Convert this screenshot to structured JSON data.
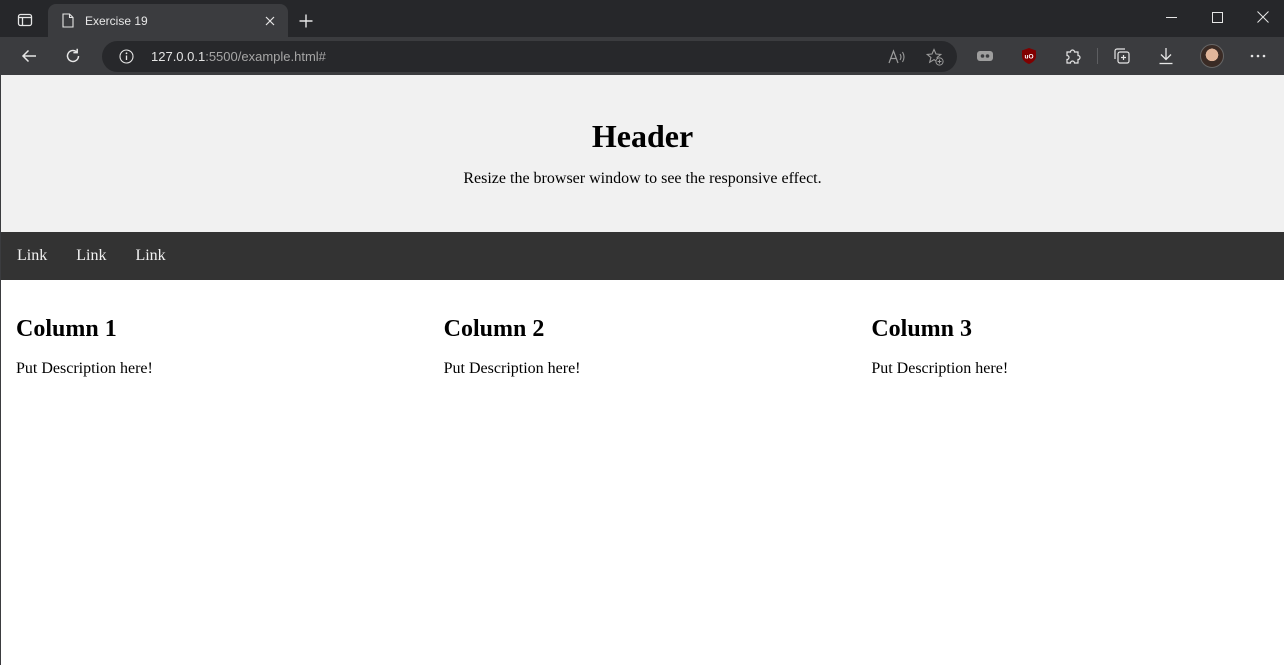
{
  "browser": {
    "tab_title": "Exercise 19",
    "url_host": "127.0.0.1",
    "url_rest": ":5500/example.html#"
  },
  "page": {
    "header": {
      "title": "Header",
      "subtitle": "Resize the browser window to see the responsive effect."
    },
    "nav": {
      "links": [
        "Link",
        "Link",
        "Link"
      ]
    },
    "columns": [
      {
        "title": "Column 1",
        "description": "Put Description here!"
      },
      {
        "title": "Column 2",
        "description": "Put Description here!"
      },
      {
        "title": "Column 3",
        "description": "Put Description here!"
      }
    ]
  },
  "colors": {
    "header_bg": "#f1f1f1",
    "nav_bg": "#333333",
    "nav_link": "#f2f2f2",
    "browser_toolbar": "#3b3c3f",
    "ublock_red": "#800000"
  },
  "icons": {
    "tab_actions": "tab-actions-icon",
    "page": "page-icon",
    "close": "close-icon",
    "new_tab": "plus-icon",
    "back": "arrow-left-icon",
    "reload": "reload-icon",
    "info": "info-icon",
    "read_aloud": "read-aloud-icon",
    "favorite": "favorite-add-icon",
    "extensions": "puzzle-icon",
    "collections": "collections-icon",
    "downloads": "download-icon",
    "more": "more-icon"
  }
}
